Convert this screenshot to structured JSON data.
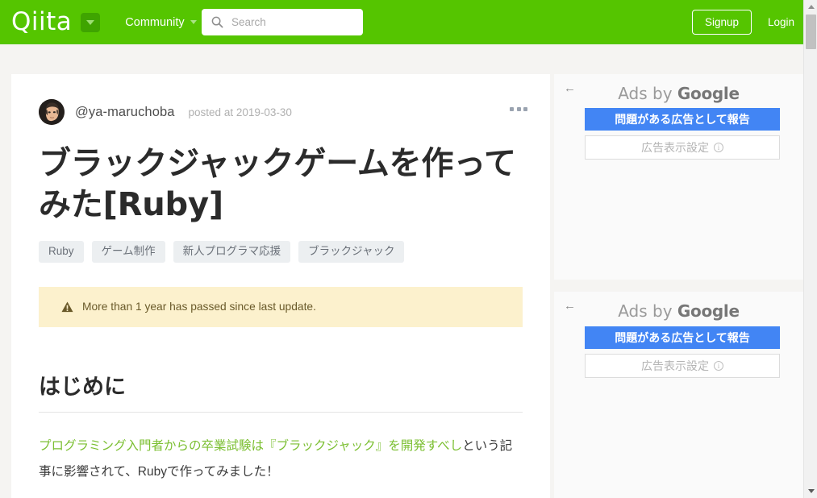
{
  "header": {
    "logo_text": "Qiita",
    "logo_dropdown_icon": "chevron-down-icon",
    "community_label": "Community",
    "community_caret_icon": "chevron-down-icon",
    "search": {
      "icon": "search-icon",
      "placeholder": "Search",
      "value": ""
    },
    "signup_label": "Signup",
    "login_label": "Login",
    "background_color": "#55c500"
  },
  "article": {
    "avatar_alt": "user-avatar",
    "author": "@ya-maruchoba",
    "posted_at": "posted at 2019-03-30",
    "more_menu_icon": "ellipsis-icon",
    "title": "ブラックジャックゲームを作ってみた[Ruby]",
    "tags": [
      "Ruby",
      "ゲーム制作",
      "新人プログラマ応援",
      "ブラックジャック"
    ],
    "notice": {
      "icon": "warning-triangle-icon",
      "text": "More than 1 year has passed since last update.",
      "background_color": "#fcf1cd"
    },
    "section_heading": "はじめに",
    "paragraph": {
      "link_text": "プログラミング入門者からの卒業試験は『ブラックジャック』を開発すべし",
      "rest_text": "という記事に影響されて、Rubyで作ってみました！",
      "link_color": "#7bbf31"
    }
  },
  "ads": [
    {
      "back_icon": "arrow-left-icon",
      "brand_prefix": "Ads by ",
      "brand_name": "Google",
      "report_label": "問題がある広告として報告",
      "report_color": "#4285f4",
      "settings_label": "広告表示設定",
      "settings_info_icon": "info-icon"
    },
    {
      "back_icon": "arrow-left-icon",
      "brand_prefix": "Ads by ",
      "brand_name": "Google",
      "report_label": "問題がある広告として報告",
      "report_color": "#4285f4",
      "settings_label": "広告表示設定",
      "settings_info_icon": "info-icon"
    }
  ],
  "scrollbar": {
    "up_icon": "triangle-up-icon",
    "down_icon": "triangle-down-icon",
    "thumb": "scroll-thumb"
  }
}
